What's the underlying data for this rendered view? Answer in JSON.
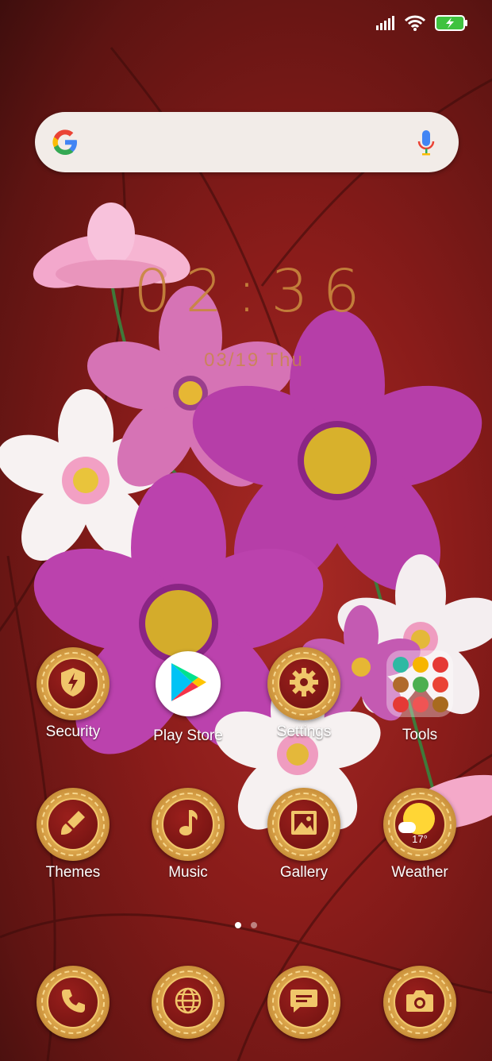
{
  "status": {
    "signal_icon": "cellular-signal-icon",
    "wifi_icon": "wifi-icon",
    "battery_icon": "battery-charging-icon",
    "battery_color": "#3fc23f"
  },
  "search": {
    "logo_icon": "google-g-icon",
    "mic_icon": "microphone-icon",
    "placeholder": ""
  },
  "clock": {
    "time": "02:36",
    "date": "03/19  Thu",
    "color": "#c8883e"
  },
  "apps": [
    {
      "label": "Security",
      "icon": "shield-lightning-icon"
    },
    {
      "label": "Play Store",
      "icon": "play-store-icon"
    },
    {
      "label": "Settings",
      "icon": "gear-icon"
    },
    {
      "label": "Tools",
      "icon": "folder-icon"
    },
    {
      "label": "Themes",
      "icon": "paintbrush-icon"
    },
    {
      "label": "Music",
      "icon": "music-note-icon"
    },
    {
      "label": "Gallery",
      "icon": "picture-icon"
    },
    {
      "label": "Weather",
      "icon": "weather-sun-icon",
      "temperature": "17°"
    }
  ],
  "folder_items": [
    "#2eb9a3",
    "#f7b500",
    "#e53935",
    "#b06a2c",
    "#4caf50",
    "#ea4335",
    "#e53935",
    "#f05454",
    "#a86a1e"
  ],
  "pages": {
    "count": 2,
    "active": 0
  },
  "dock": [
    {
      "icon": "phone-icon"
    },
    {
      "icon": "globe-icon"
    },
    {
      "icon": "message-icon"
    },
    {
      "icon": "camera-icon"
    }
  ],
  "colors": {
    "wallpaper": "#8a1c1a",
    "gold": "#d9a248",
    "app_core": "#7f1715"
  }
}
